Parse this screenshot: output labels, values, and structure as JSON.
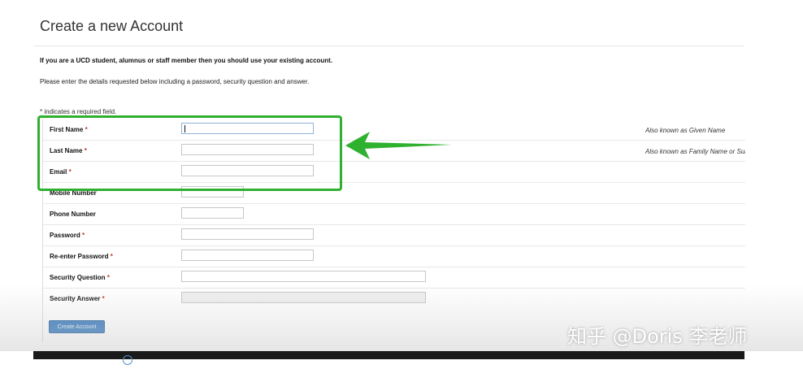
{
  "page": {
    "title": "Create a new Account",
    "notice": "If you are a UCD student, alumnus or staff member then you should use your existing account.",
    "instructions": "Please enter the details requested below including a password, security question and answer.",
    "required_note": "* indicates a required field."
  },
  "form": {
    "fields": [
      {
        "label": "First Name",
        "required": "*",
        "hint": "Also known as Given Name",
        "value": ""
      },
      {
        "label": "Last Name",
        "required": "*",
        "hint": "Also known as Family Name or Surname",
        "value": ""
      },
      {
        "label": "Email",
        "required": "*",
        "hint": "",
        "value": ""
      },
      {
        "label": "Mobile Number",
        "required": "",
        "hint": "",
        "value": ""
      },
      {
        "label": "Phone Number",
        "required": "",
        "hint": "",
        "value": ""
      },
      {
        "label": "Password",
        "required": "*",
        "hint": "",
        "value": ""
      },
      {
        "label": "Re-enter Password",
        "required": "*",
        "hint": "",
        "value": ""
      },
      {
        "label": "Security Question",
        "required": "*",
        "hint": "",
        "value": ""
      },
      {
        "label": "Security Answer",
        "required": "*",
        "hint": "",
        "value": ""
      }
    ],
    "submit_label": "Create Account"
  },
  "overlay": {
    "highlight_color": "#2fb12f",
    "watermark": "知乎 @Doris 李老师"
  },
  "colors": {
    "button": "#3f7fc1",
    "required": "#c0392b"
  }
}
